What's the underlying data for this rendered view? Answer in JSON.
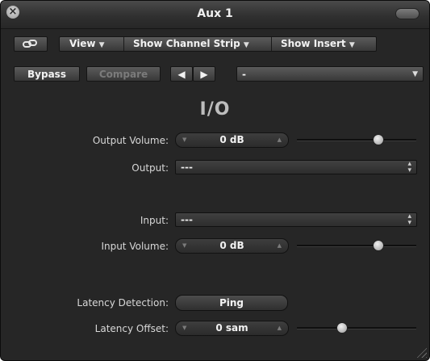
{
  "window": {
    "title": "Aux 1"
  },
  "toolbar": {
    "link_icon": "link-icon",
    "view": "View",
    "show_channel_strip": "Show Channel Strip",
    "show_insert": "Show Insert",
    "bypass": "Bypass",
    "compare": "Compare",
    "prev_icon": "left-arrow-icon",
    "next_icon": "right-arrow-icon",
    "preset": "-"
  },
  "plugin": {
    "section_title": "I/O",
    "output_volume": {
      "label": "Output Volume:",
      "value": "0 dB",
      "level": 0.68
    },
    "output": {
      "label": "Output:",
      "value": "---"
    },
    "input": {
      "label": "Input:",
      "value": "---"
    },
    "input_volume": {
      "label": "Input Volume:",
      "value": "0 dB",
      "level": 0.68
    },
    "latency_detection": {
      "label": "Latency Detection:",
      "button": "Ping"
    },
    "latency_offset": {
      "label": "Latency Offset:",
      "value": "0 sam",
      "level": 0.38
    }
  },
  "colors": {
    "background": "#262626",
    "text": "#d8d8d8"
  }
}
